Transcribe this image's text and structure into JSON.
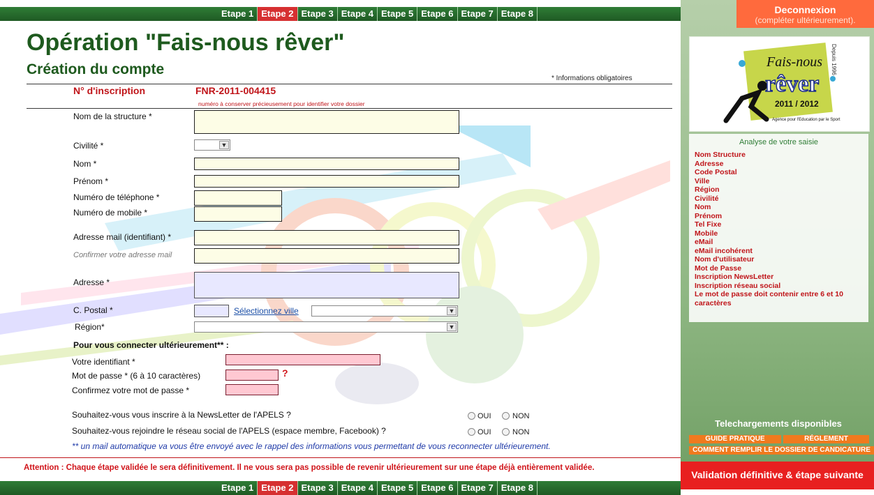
{
  "steps": [
    "Etape 1",
    "Etape 2",
    "Etape 3",
    "Etape 4",
    "Etape 5",
    "Etape 6",
    "Etape 7",
    "Etape 8"
  ],
  "active_step": "Etape 2",
  "logout": {
    "label": "Deconnexion",
    "sub": "(compléter ultérieurement)."
  },
  "page": {
    "title": "Opération \"Fais-nous rêver\"",
    "subtitle": "Création du compte",
    "required_note": "* Informations obligatoires"
  },
  "inscription": {
    "label": "N° d'inscription",
    "value": "FNR-2011-004415",
    "hint": "numéro à conserver précieusement pour identifier votre dossier"
  },
  "form": {
    "structure": "Nom de la structure *",
    "civilite": "Civilité *",
    "nom": "Nom *",
    "prenom": "Prénom *",
    "tel": "Numéro de téléphone *",
    "mobile": "Numéro de mobile *",
    "email": "Adresse mail (identifiant) *",
    "email_confirm": "Confirmer votre adresse mail",
    "adresse": "Adresse *",
    "cp": "C. Postal *",
    "select_ville": "Sélectionnez ville",
    "region": "Région*"
  },
  "login": {
    "title": "Pour vous connecter ultérieurement** :",
    "identifiant": "Votre identifiant *",
    "password": "Mot de passe * (6 à 10 caractères)",
    "password_help": "?",
    "password_confirm": "Confirmez votre mot de passe *"
  },
  "newsletter": {
    "question": "Souhaitez-vous vous inscrire à la NewsLetter de l'APELS ?",
    "oui": "OUI",
    "non": "NON"
  },
  "social": {
    "question": "Souhaitez-vous rejoindre le réseau social de l'APELS (espace membre, Facebook) ?",
    "oui": "OUI",
    "non": "NON"
  },
  "mail_note": "** un mail automatique va vous être envoyé avec le rappel des informations vous permettant de vous reconnecter ultérieurement.",
  "attention": "Attention : Chaque étape validée le sera définitivement. Il ne vous sera pas possible de revenir ultérieurement sur une étape déjà entièrement validée.",
  "logo": {
    "line1": "Fais-nous",
    "line2": "rêver",
    "line3": "2011 / 2012",
    "side": "Depuis 1996",
    "footer": "Agence pour l'Education par le Sport"
  },
  "analysis": {
    "title": "Analyse de votre saisie",
    "items": [
      "Nom Structure",
      "Adresse",
      "Code Postal",
      "Ville",
      "Région",
      "Civilité",
      "Nom",
      "Prénom",
      "Tel Fixe",
      "Mobile",
      "eMail",
      "eMail incohérent",
      "Nom d'utilisateur",
      "Mot de Passe",
      "Inscription NewsLetter",
      "Inscription réseau social",
      "Le mot de passe doit contenir entre 6 et 10 caractères"
    ]
  },
  "downloads": {
    "title": "Telechargements disponibles",
    "guide": "GUIDE PRATIQUE",
    "reglement": "RÉGLEMENT",
    "comment": "COMMENT REMPLIR LE DOSSIER DE CANDICATURE"
  },
  "validate": "Validation définitive & étape suivante",
  "colors": {
    "green": "#1e5a1e",
    "red": "#c0151a",
    "orange": "#ff6a3d",
    "sidebar": "#8fb783"
  }
}
